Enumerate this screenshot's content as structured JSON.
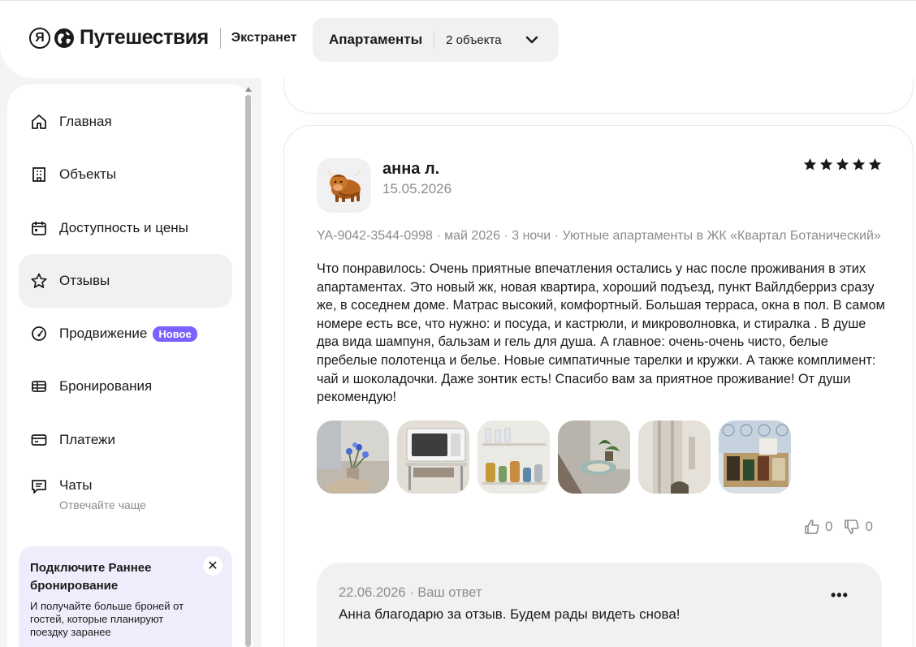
{
  "header": {
    "logo_ya": "Я",
    "logo_text": "Путешествия",
    "section": "Экстранет",
    "selector_title": "Апартаменты",
    "selector_count": "2 объекта"
  },
  "sidebar": {
    "items": [
      {
        "label": "Главная",
        "icon": "home-icon"
      },
      {
        "label": "Объекты",
        "icon": "building-icon"
      },
      {
        "label": "Доступность и цены",
        "icon": "calendar-icon"
      },
      {
        "label": "Отзывы",
        "icon": "star-icon"
      },
      {
        "label": "Продвижение",
        "icon": "gauge-icon",
        "badge": "Новое"
      },
      {
        "label": "Бронирования",
        "icon": "table-icon"
      },
      {
        "label": "Платежи",
        "icon": "card-icon"
      },
      {
        "label": "Чаты",
        "icon": "chat-icon",
        "sub": "Отвечайте чаще"
      }
    ],
    "promo": {
      "title": "Подключите Раннее бронирование",
      "text": "И получайте больше броней от гостей, которые планируют поездку заранее"
    }
  },
  "review": {
    "author": "анна л.",
    "date": "15.05.2026",
    "rating": 5,
    "meta": "YA-9042-3544-0998 · май 2026 · 3 ночи · Уютные апартаменты в ЖК «Квартал Ботанический»",
    "text": "Что понравилось: Очень приятные впечатления остались у нас после проживания в этих апартаментах. Это новый жк, новая квартира, хороший подъезд, пункт Вайлдберриз сразу же, в соседнем доме. Матрас высокий, комфортный. Большая терраса, окна в пол. В самом номере есть все, что нужно: и посуда, и кастрюли, и микроволновка, и стиралка . В душе два вида шампуня, бальзам и гель для душа. А главное: очень-очень чисто, белые пребелые полотенца и белье. Новые симпатичные тарелки и кружки. А также комплимент: чай и шоколадочки. Даже зонтик есть! Спасибо вам за приятное проживание! От души рекомендую!",
    "likes": "0",
    "dislikes": "0",
    "answer_meta": "22.06.2026 · Ваш ответ",
    "answer_text": "Анна благодарю за отзыв. Будем рады видеть снова!"
  },
  "colors": {
    "accent": "#7b61ff",
    "active_bg": "#f1f1f3",
    "promo_bg": "#efedfb",
    "muted": "#8c8c8c"
  }
}
